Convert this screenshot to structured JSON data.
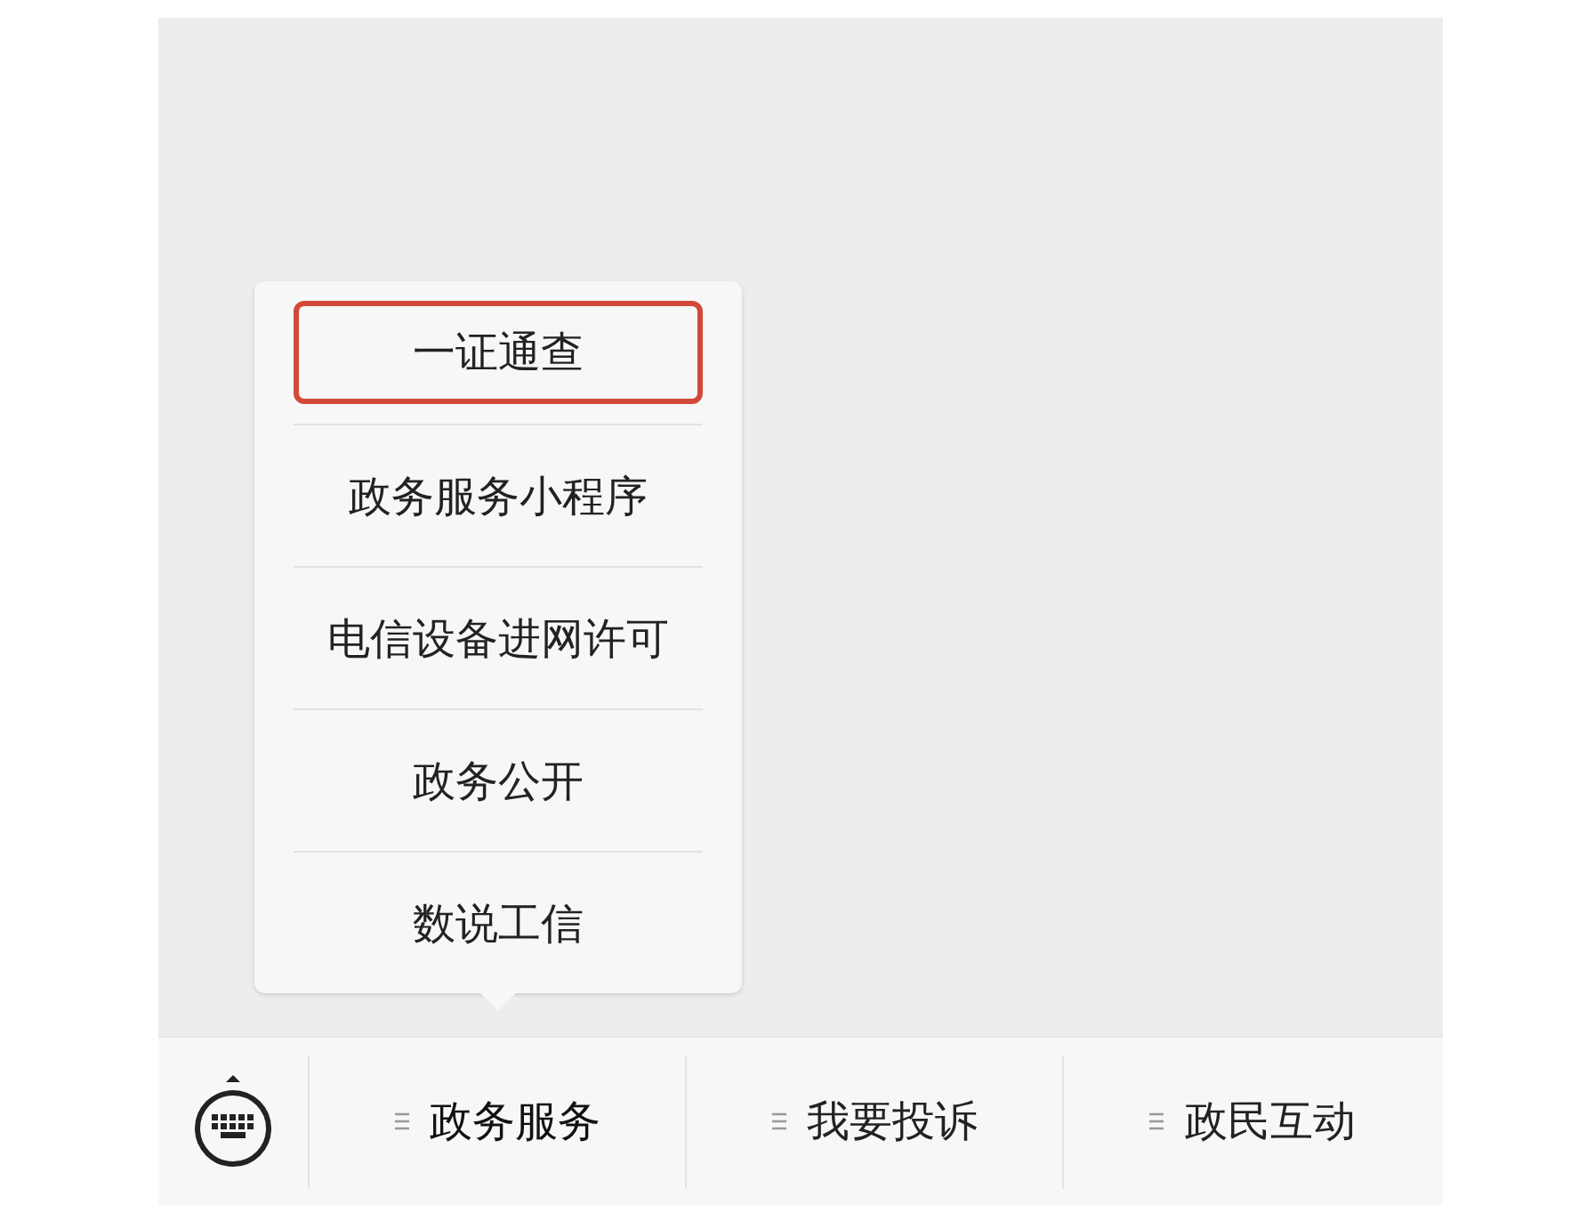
{
  "submenu": {
    "items": [
      {
        "label": "一证通查",
        "highlighted": true
      },
      {
        "label": "政务服务小程序",
        "highlighted": false
      },
      {
        "label": "电信设备进网许可",
        "highlighted": false
      },
      {
        "label": "政务公开",
        "highlighted": false
      },
      {
        "label": "数说工信",
        "highlighted": false
      }
    ]
  },
  "menu_bar": {
    "tabs": [
      {
        "label": "政务服务",
        "expanded": true
      },
      {
        "label": "我要投诉",
        "expanded": false
      },
      {
        "label": "政民互动",
        "expanded": false
      }
    ]
  }
}
